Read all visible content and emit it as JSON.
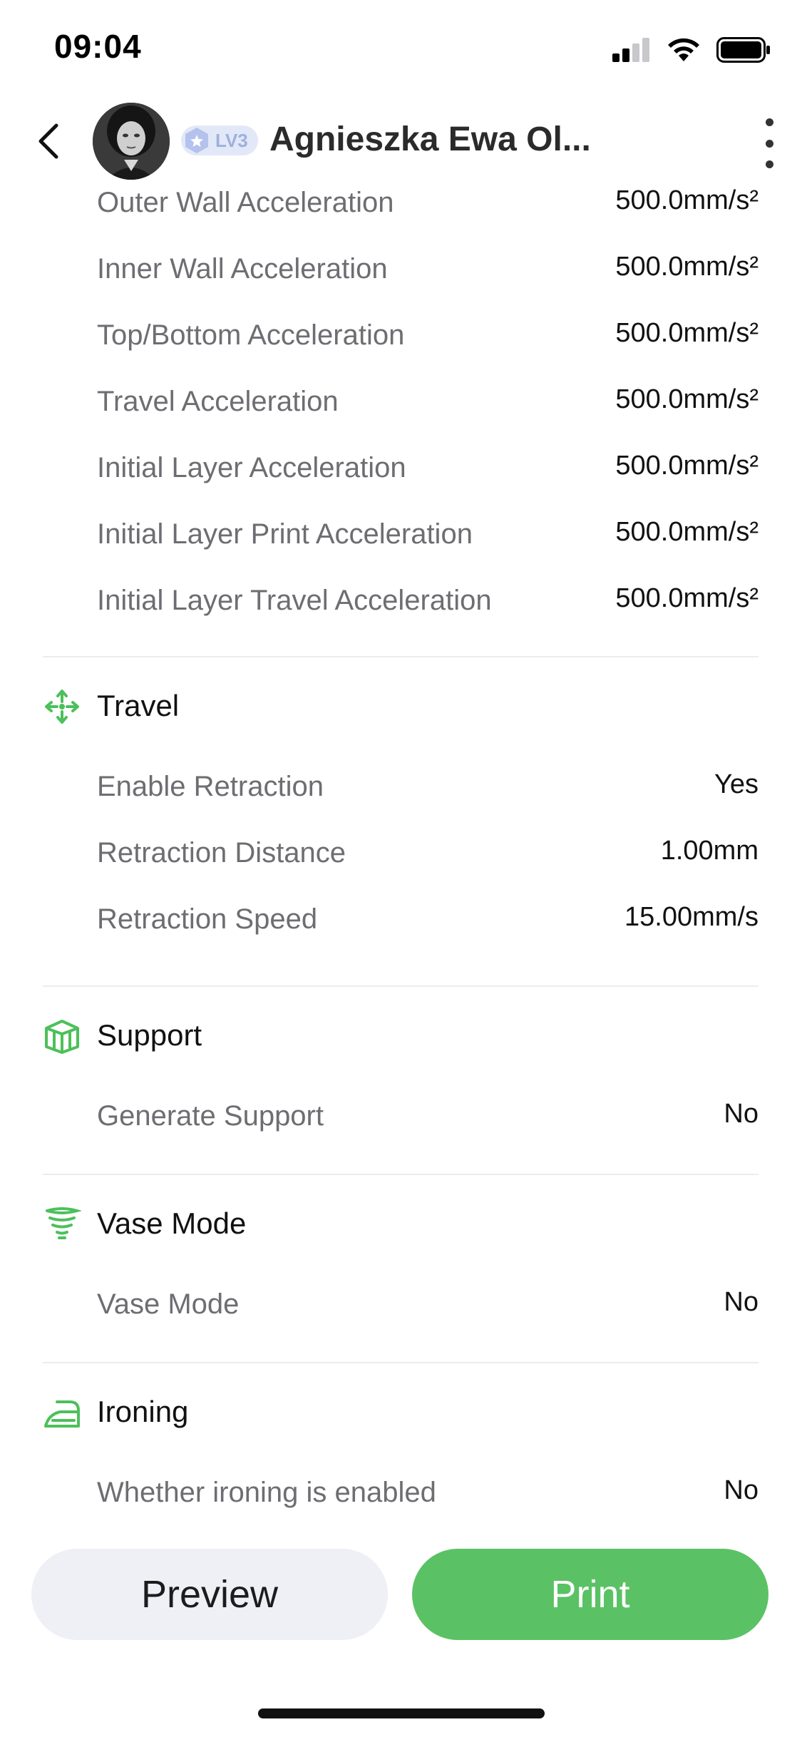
{
  "status_bar": {
    "time": "09:04"
  },
  "header": {
    "level_badge": "LV3",
    "user_name": "Agnieszka Ewa Ol..."
  },
  "acceleration_rows": [
    {
      "label": "Outer Wall Acceleration",
      "value": "500.0mm/s²"
    },
    {
      "label": "Inner Wall Acceleration",
      "value": "500.0mm/s²"
    },
    {
      "label": "Top/Bottom Acceleration",
      "value": "500.0mm/s²"
    },
    {
      "label": "Travel Acceleration",
      "value": "500.0mm/s²"
    },
    {
      "label": "Initial Layer Acceleration",
      "value": "500.0mm/s²"
    },
    {
      "label": "Initial Layer Print Acceleration",
      "value": "500.0mm/s²"
    },
    {
      "label": "Initial Layer Travel Acceleration",
      "value": "500.0mm/s²"
    }
  ],
  "sections": {
    "travel": {
      "title": "Travel",
      "icon": "move-arrows-icon",
      "rows": [
        {
          "label": "Enable Retraction",
          "value": "Yes"
        },
        {
          "label": "Retraction Distance",
          "value": "1.00mm"
        },
        {
          "label": "Retraction Speed",
          "value": "15.00mm/s"
        }
      ]
    },
    "support": {
      "title": "Support",
      "icon": "support-box-icon",
      "rows": [
        {
          "label": "Generate Support",
          "value": "No"
        }
      ]
    },
    "vase_mode": {
      "title": "Vase Mode",
      "icon": "vase-spiral-icon",
      "rows": [
        {
          "label": "Vase Mode",
          "value": "No"
        }
      ]
    },
    "ironing": {
      "title": "Ironing",
      "icon": "iron-icon",
      "rows": [
        {
          "label": "Whether ironing is enabled",
          "value": "No"
        }
      ]
    }
  },
  "actions": {
    "preview_label": "Preview",
    "print_label": "Print"
  },
  "colors": {
    "accent_green": "#5ac264",
    "icon_green": "#4cc05a",
    "preview_bg": "#eef0f5",
    "badge_bg": "#e3e8f8"
  }
}
